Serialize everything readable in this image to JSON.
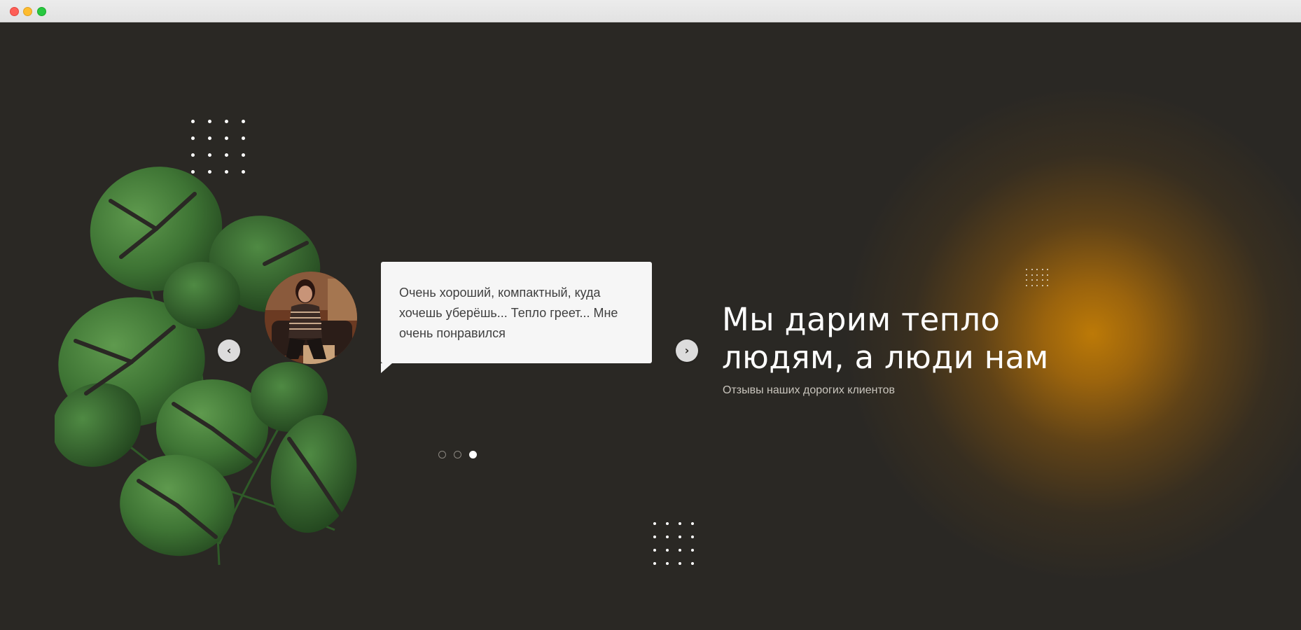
{
  "window": {
    "controls": [
      "close",
      "minimize",
      "maximize"
    ]
  },
  "testimonial": {
    "text": "Очень хороший, компактный, куда хочешь уберёшь... Тепло греет... Мне очень понравился",
    "prev_icon": "chevron-left-icon",
    "next_icon": "chevron-right-icon",
    "pages": 3,
    "active_page": 3
  },
  "hero": {
    "title_line1": "Мы дарим тепло",
    "title_line2": "людям, а люди нам",
    "subtitle": "Отзывы наших дорогих клиентов"
  },
  "colors": {
    "background": "#2a2824",
    "glow": "#c47e06",
    "bubble": "#f6f6f6",
    "text_light": "#ffffff"
  }
}
